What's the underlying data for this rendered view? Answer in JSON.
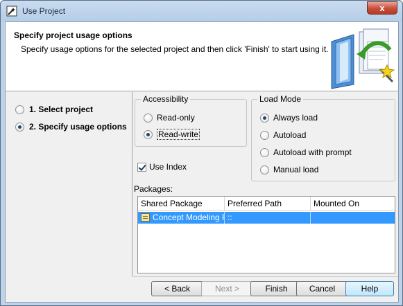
{
  "window": {
    "title": "Use Project",
    "close_label": "x",
    "app_icon": "wizard-icon"
  },
  "header": {
    "title": "Specify project usage options",
    "description": "Specify usage options for the selected project and then click 'Finish' to start using it.",
    "art": "project-books-illustration"
  },
  "steps": [
    {
      "label": "1. Select project",
      "selected": false
    },
    {
      "label": "2. Specify usage options",
      "selected": true
    }
  ],
  "accessibility": {
    "title": "Accessibility",
    "options": [
      {
        "label": "Read-only",
        "selected": false
      },
      {
        "label": "Read-write",
        "selected": true
      }
    ]
  },
  "load_mode": {
    "title": "Load Mode",
    "options": [
      {
        "label": "Always load",
        "selected": true
      },
      {
        "label": "Autoload",
        "selected": false
      },
      {
        "label": "Autoload with prompt",
        "selected": false
      },
      {
        "label": "Manual load",
        "selected": false
      }
    ]
  },
  "use_index": {
    "label": "Use Index",
    "checked": true
  },
  "packages": {
    "label": "Packages:",
    "columns": [
      "Shared Package",
      "Preferred Path",
      "Mounted On"
    ],
    "rows": [
      {
        "shared_package": "Concept Modeling P...",
        "preferred_path": "::",
        "mounted_on": ""
      }
    ]
  },
  "buttons": {
    "back": "< Back",
    "next": "Next >",
    "finish": "Finish",
    "cancel": "Cancel",
    "help": "Help"
  },
  "colors": {
    "selection": "#3399ff",
    "titlebar": "#b5cde6",
    "close": "#c74d38"
  }
}
